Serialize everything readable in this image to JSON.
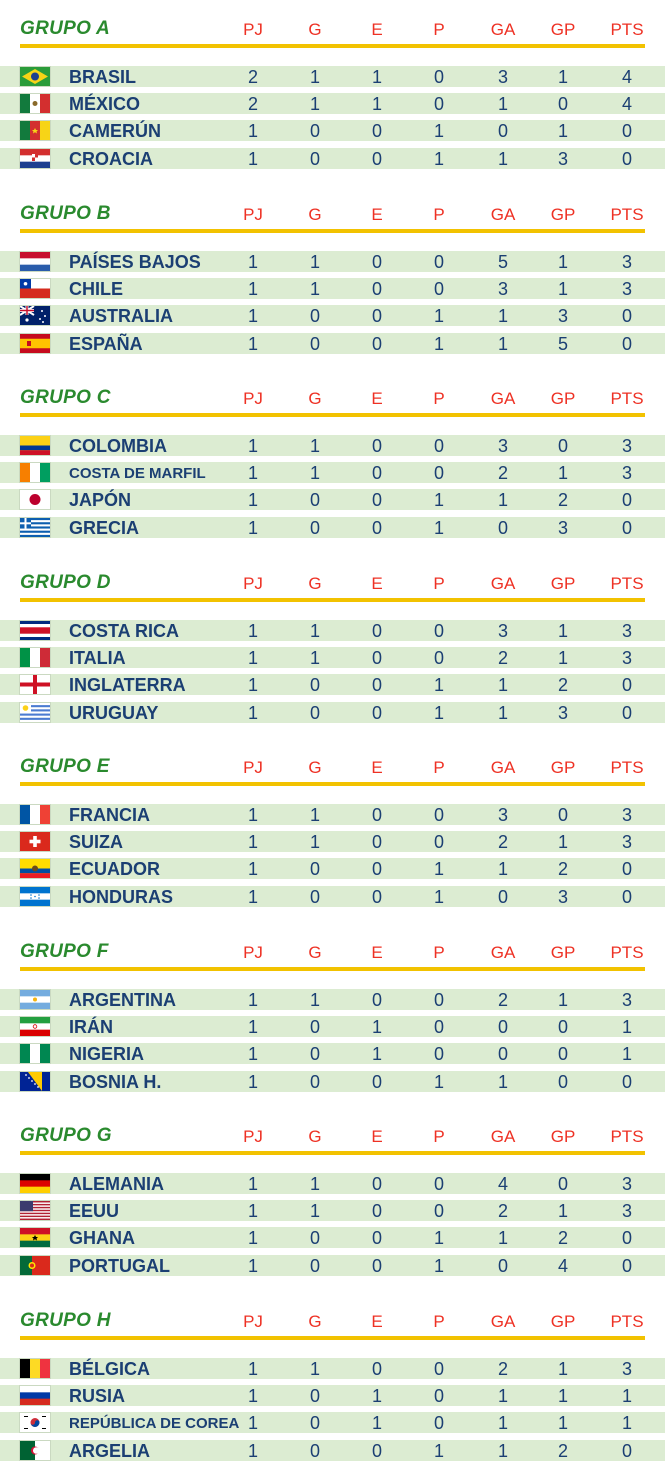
{
  "columns": [
    "PJ",
    "G",
    "E",
    "P",
    "GA",
    "GP",
    "PTS"
  ],
  "groups": [
    {
      "title": "GRUPO A",
      "teams": [
        {
          "name": "BRASIL",
          "flag": "brazil-flag-icon",
          "stats": [
            "2",
            "1",
            "1",
            "0",
            "3",
            "1",
            "4"
          ]
        },
        {
          "name": "MÉXICO",
          "flag": "mexico-flag-icon",
          "stats": [
            "2",
            "1",
            "1",
            "0",
            "1",
            "0",
            "4"
          ]
        },
        {
          "name": "CAMERÚN",
          "flag": "cameroon-flag-icon",
          "stats": [
            "1",
            "0",
            "0",
            "1",
            "0",
            "1",
            "0"
          ]
        },
        {
          "name": "CROACIA",
          "flag": "croatia-flag-icon",
          "stats": [
            "1",
            "0",
            "0",
            "1",
            "1",
            "3",
            "0"
          ]
        }
      ]
    },
    {
      "title": "GRUPO B",
      "teams": [
        {
          "name": "PAÍSES BAJOS",
          "flag": "netherlands-flag-icon",
          "stats": [
            "1",
            "1",
            "0",
            "0",
            "5",
            "1",
            "3"
          ]
        },
        {
          "name": "CHILE",
          "flag": "chile-flag-icon",
          "stats": [
            "1",
            "1",
            "0",
            "0",
            "3",
            "1",
            "3"
          ]
        },
        {
          "name": "AUSTRALIA",
          "flag": "australia-flag-icon",
          "stats": [
            "1",
            "0",
            "0",
            "1",
            "1",
            "3",
            "0"
          ]
        },
        {
          "name": "ESPAÑA",
          "flag": "spain-flag-icon",
          "stats": [
            "1",
            "0",
            "0",
            "1",
            "1",
            "5",
            "0"
          ]
        }
      ]
    },
    {
      "title": "GRUPO C",
      "teams": [
        {
          "name": "COLOMBIA",
          "flag": "colombia-flag-icon",
          "stats": [
            "1",
            "1",
            "0",
            "0",
            "3",
            "0",
            "3"
          ]
        },
        {
          "name": "COSTA DE MARFIL",
          "flag": "ivory-coast-flag-icon",
          "stats": [
            "1",
            "1",
            "0",
            "0",
            "2",
            "1",
            "3"
          ]
        },
        {
          "name": "JAPÓN",
          "flag": "japan-flag-icon",
          "stats": [
            "1",
            "0",
            "0",
            "1",
            "1",
            "2",
            "0"
          ]
        },
        {
          "name": "GRECIA",
          "flag": "greece-flag-icon",
          "stats": [
            "1",
            "0",
            "0",
            "1",
            "0",
            "3",
            "0"
          ]
        }
      ]
    },
    {
      "title": "GRUPO D",
      "teams": [
        {
          "name": "COSTA RICA",
          "flag": "costa-rica-flag-icon",
          "stats": [
            "1",
            "1",
            "0",
            "0",
            "3",
            "1",
            "3"
          ]
        },
        {
          "name": "ITALIA",
          "flag": "italy-flag-icon",
          "stats": [
            "1",
            "1",
            "0",
            "0",
            "2",
            "1",
            "3"
          ]
        },
        {
          "name": "INGLATERRA",
          "flag": "england-flag-icon",
          "stats": [
            "1",
            "0",
            "0",
            "1",
            "1",
            "2",
            "0"
          ]
        },
        {
          "name": "URUGUAY",
          "flag": "uruguay-flag-icon",
          "stats": [
            "1",
            "0",
            "0",
            "1",
            "1",
            "3",
            "0"
          ]
        }
      ]
    },
    {
      "title": "GRUPO E",
      "teams": [
        {
          "name": "FRANCIA",
          "flag": "france-flag-icon",
          "stats": [
            "1",
            "1",
            "0",
            "0",
            "3",
            "0",
            "3"
          ]
        },
        {
          "name": "SUIZA",
          "flag": "switzerland-flag-icon",
          "stats": [
            "1",
            "1",
            "0",
            "0",
            "2",
            "1",
            "3"
          ]
        },
        {
          "name": "ECUADOR",
          "flag": "ecuador-flag-icon",
          "stats": [
            "1",
            "0",
            "0",
            "1",
            "1",
            "2",
            "0"
          ]
        },
        {
          "name": "HONDURAS",
          "flag": "honduras-flag-icon",
          "stats": [
            "1",
            "0",
            "0",
            "1",
            "0",
            "3",
            "0"
          ]
        }
      ]
    },
    {
      "title": "GRUPO F",
      "teams": [
        {
          "name": "ARGENTINA",
          "flag": "argentina-flag-icon",
          "stats": [
            "1",
            "1",
            "0",
            "0",
            "2",
            "1",
            "3"
          ]
        },
        {
          "name": "IRÁN",
          "flag": "iran-flag-icon",
          "stats": [
            "1",
            "0",
            "1",
            "0",
            "0",
            "0",
            "1"
          ]
        },
        {
          "name": "NIGERIA",
          "flag": "nigeria-flag-icon",
          "stats": [
            "1",
            "0",
            "1",
            "0",
            "0",
            "0",
            "1"
          ]
        },
        {
          "name": "BOSNIA H.",
          "flag": "bosnia-flag-icon",
          "stats": [
            "1",
            "0",
            "0",
            "1",
            "1",
            "0",
            "0"
          ]
        }
      ]
    },
    {
      "title": "GRUPO G",
      "teams": [
        {
          "name": "ALEMANIA",
          "flag": "germany-flag-icon",
          "stats": [
            "1",
            "1",
            "0",
            "0",
            "4",
            "0",
            "3"
          ]
        },
        {
          "name": "EEUU",
          "flag": "usa-flag-icon",
          "stats": [
            "1",
            "1",
            "0",
            "0",
            "2",
            "1",
            "3"
          ]
        },
        {
          "name": "GHANA",
          "flag": "ghana-flag-icon",
          "stats": [
            "1",
            "0",
            "0",
            "1",
            "1",
            "2",
            "0"
          ]
        },
        {
          "name": "PORTUGAL",
          "flag": "portugal-flag-icon",
          "stats": [
            "1",
            "0",
            "0",
            "1",
            "0",
            "4",
            "0"
          ]
        }
      ]
    },
    {
      "title": "GRUPO H",
      "teams": [
        {
          "name": "BÉLGICA",
          "flag": "belgium-flag-icon",
          "stats": [
            "1",
            "1",
            "0",
            "0",
            "2",
            "1",
            "3"
          ]
        },
        {
          "name": "RUSIA",
          "flag": "russia-flag-icon",
          "stats": [
            "1",
            "0",
            "1",
            "0",
            "1",
            "1",
            "1"
          ]
        },
        {
          "name": "REPÚBLICA DE COREA",
          "flag": "korea-flag-icon",
          "stats": [
            "1",
            "0",
            "1",
            "0",
            "1",
            "1",
            "1"
          ]
        },
        {
          "name": "ARGELIA",
          "flag": "algeria-flag-icon",
          "stats": [
            "1",
            "0",
            "0",
            "1",
            "1",
            "2",
            "0"
          ]
        }
      ]
    }
  ]
}
